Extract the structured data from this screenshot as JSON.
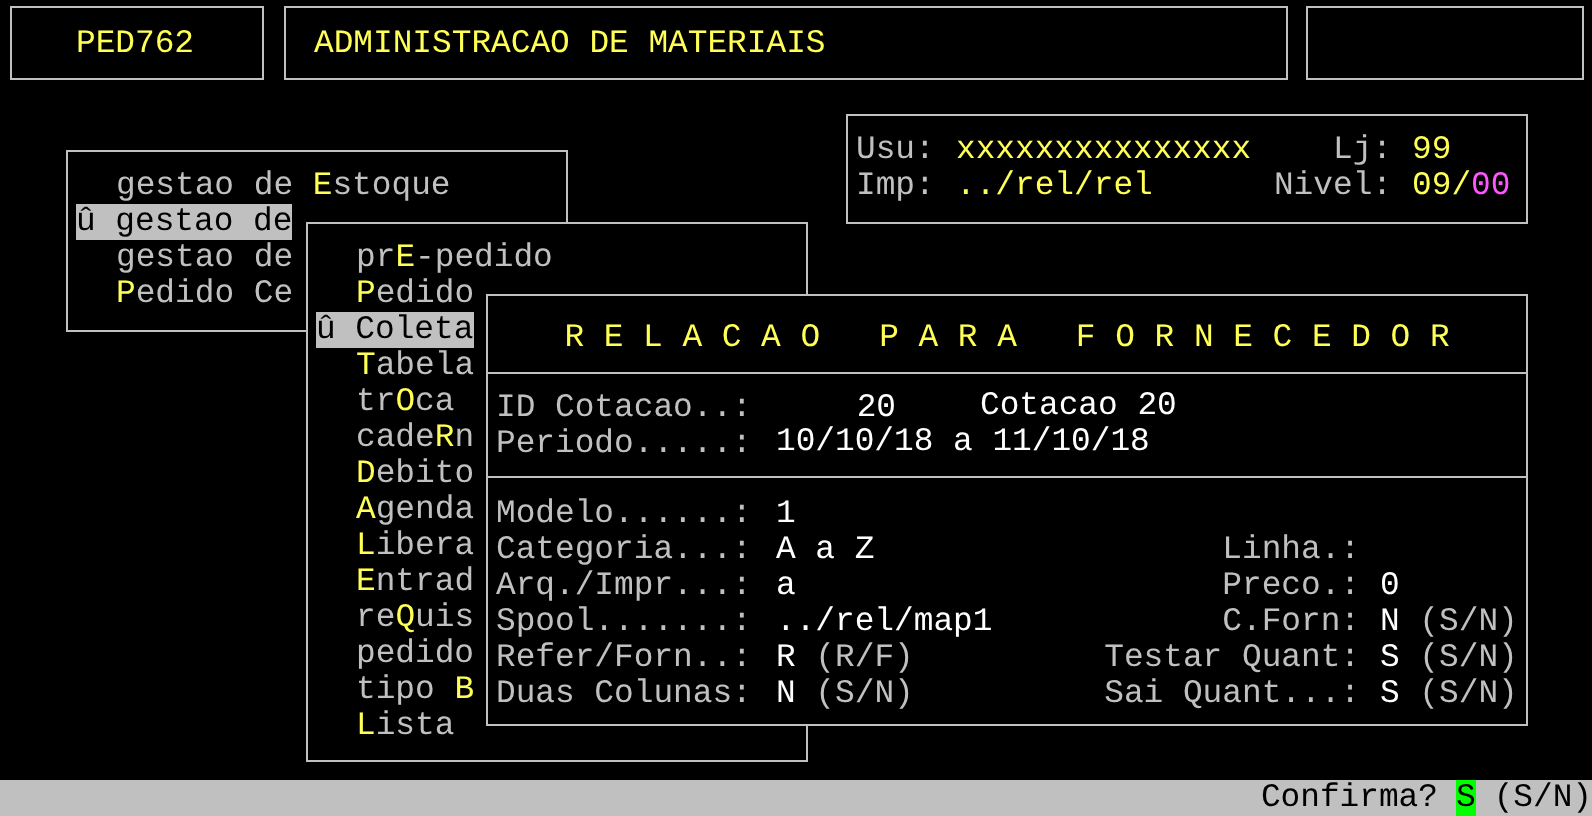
{
  "header": {
    "program": "PED762",
    "title": "ADMINISTRACAO DE MATERIAIS"
  },
  "session": {
    "user_label": "Usu:",
    "user": "xxxxxxxxxxxxxxx",
    "store_label": "Lj:",
    "store": "99",
    "printer_label": "Imp:",
    "printer": "../rel/rel",
    "level_label": "Nivel:",
    "level_main": "09",
    "level_sep": "/",
    "level_sub": "00"
  },
  "main_menu": [
    {
      "prefix": "gestao de ",
      "hotkey": "E",
      "suffix": "stoque",
      "selected": false
    },
    {
      "prefix": "û gestao de",
      "selected": true
    },
    {
      "prefix": "gestao de",
      "selected": false
    },
    {
      "hotkey": "P",
      "suffix": "edido Ce",
      "selected": false
    }
  ],
  "sub_menu": [
    {
      "prefix": "pr",
      "hotkey": "E",
      "suffix": "-pedido",
      "selected": false
    },
    {
      "hotkey": "P",
      "suffix": "edido",
      "selected": false
    },
    {
      "prefix": "û Coleta",
      "selected": true
    },
    {
      "hotkey": "T",
      "suffix": "abela",
      "selected": false
    },
    {
      "prefix": "tr",
      "hotkey": "O",
      "suffix": "ca",
      "selected": false
    },
    {
      "prefix": "cade",
      "hotkey": "R",
      "suffix": "n",
      "selected": false
    },
    {
      "hotkey": "D",
      "suffix": "ebito",
      "selected": false
    },
    {
      "hotkey": "A",
      "suffix": "genda",
      "selected": false
    },
    {
      "hotkey": "L",
      "suffix": "ibera",
      "selected": false
    },
    {
      "hotkey": "E",
      "suffix": "ntrad",
      "selected": false
    },
    {
      "prefix": "re",
      "hotkey": "Q",
      "suffix": "uis",
      "selected": false
    },
    {
      "prefix": "pedido",
      "selected": false
    },
    {
      "prefix": "tipo ",
      "hotkey": "B",
      "selected": false
    },
    {
      "hotkey": "L",
      "suffix": "ista",
      "selected": false
    }
  ],
  "dialog": {
    "title": "R E L A C A O   P A R A   F O R N E C E D O R",
    "id_cotacao": {
      "label": "ID Cotacao..:",
      "value": "20",
      "description": "Cotacao 20"
    },
    "periodo": {
      "label": "Periodo.....:",
      "value": "10/10/18 a 11/10/18"
    },
    "rows": [
      {
        "left": {
          "label": "Modelo......:",
          "value": "1"
        }
      },
      {
        "left": {
          "label": "Categoria...:",
          "value": "A a Z"
        },
        "right": {
          "label": "Linha.:"
        }
      },
      {
        "left": {
          "label": "Arq./Impr...:",
          "value": "a"
        },
        "right": {
          "label": "Preco.:",
          "value": "0"
        }
      },
      {
        "left": {
          "label": "Spool.......:",
          "value": "../rel/map1"
        },
        "right": {
          "label": "C.Forn:",
          "value": "N",
          "hint": "(S/N)"
        }
      },
      {
        "left": {
          "label": "Refer/Forn..:",
          "value": "R",
          "hint": "(R/F)"
        },
        "right": {
          "label": "Testar Quant:",
          "value": "S",
          "hint": "(S/N)"
        }
      },
      {
        "left": {
          "label": "Duas Colunas:",
          "value": "N",
          "hint": "(S/N)"
        },
        "right": {
          "label": "Sai Quant...:",
          "value": "S",
          "hint": "(S/N)"
        }
      }
    ]
  },
  "status_bar": {
    "prompt": "Confirma?",
    "answer": "S",
    "hint": "(S/N)"
  }
}
